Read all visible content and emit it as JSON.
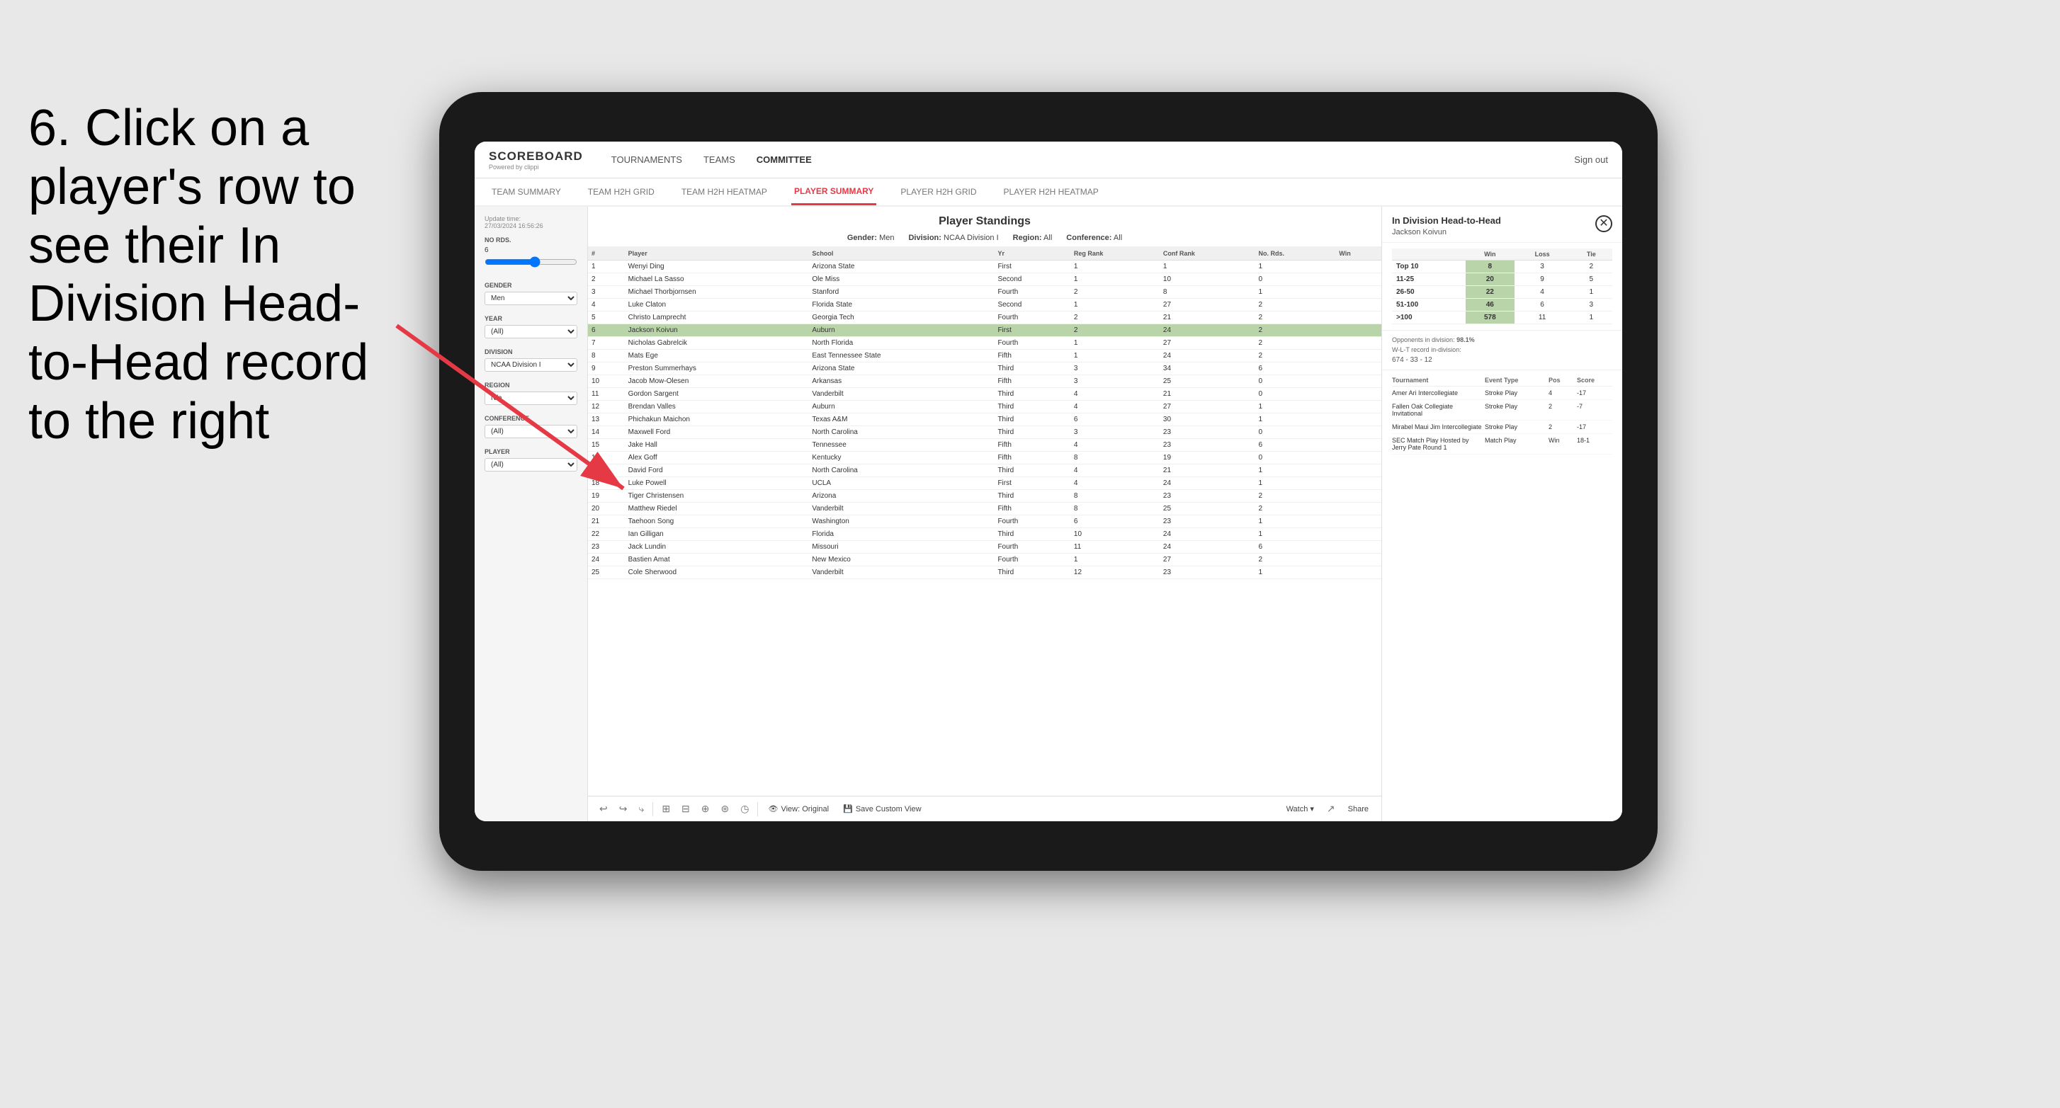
{
  "instruction": {
    "text": "6. Click on a player's row to see their In Division Head-to-Head record to the right"
  },
  "app": {
    "logo": "SCOREBOARD",
    "logo_sub": "Powered by clippi",
    "nav_links": [
      {
        "label": "TOURNAMENTS",
        "active": false
      },
      {
        "label": "TEAMS",
        "active": false
      },
      {
        "label": "COMMITTEE",
        "active": true
      }
    ],
    "sign_out": "Sign out",
    "sub_nav": [
      {
        "label": "TEAM SUMMARY",
        "active": false
      },
      {
        "label": "TEAM H2H GRID",
        "active": false
      },
      {
        "label": "TEAM H2H HEATMAP",
        "active": false
      },
      {
        "label": "PLAYER SUMMARY",
        "active": true
      },
      {
        "label": "PLAYER H2H GRID",
        "active": false
      },
      {
        "label": "PLAYER H2H HEATMAP",
        "active": false
      }
    ]
  },
  "sidebar": {
    "update_label": "Update time:",
    "update_time": "27/03/2024 16:56:26",
    "no_rds_label": "No Rds.",
    "no_rds_value": "6",
    "gender_label": "Gender",
    "gender_value": "Men",
    "year_label": "Year",
    "year_value": "(All)",
    "division_label": "Division",
    "division_value": "NCAA Division I",
    "region_label": "Region",
    "region_value": "N/a",
    "conference_label": "Conference",
    "conference_value": "(All)",
    "player_label": "Player",
    "player_value": "(All)"
  },
  "panel": {
    "title": "Player Standings",
    "gender_label": "Gender:",
    "gender_value": "Men",
    "division_label": "Division:",
    "division_value": "NCAA Division I",
    "region_label": "Region:",
    "region_value": "All",
    "conference_label": "Conference:",
    "conference_value": "All"
  },
  "table": {
    "columns": [
      "#",
      "Player",
      "School",
      "Yr",
      "Reg Rank",
      "Conf Rank",
      "No. Rds.",
      "Win"
    ],
    "rows": [
      {
        "rank": 1,
        "player": "Wenyi Ding",
        "school": "Arizona State",
        "yr": "First",
        "reg": 1,
        "conf": 1,
        "rds": 1,
        "win": ""
      },
      {
        "rank": 2,
        "player": "Michael La Sasso",
        "school": "Ole Miss",
        "yr": "Second",
        "reg": 1,
        "conf": 10,
        "rds": 0,
        "win": ""
      },
      {
        "rank": 3,
        "player": "Michael Thorbjornsen",
        "school": "Stanford",
        "yr": "Fourth",
        "reg": 2,
        "conf": 8,
        "rds": 1,
        "win": ""
      },
      {
        "rank": 4,
        "player": "Luke Claton",
        "school": "Florida State",
        "yr": "Second",
        "reg": 1,
        "conf": 27,
        "rds": 2,
        "win": ""
      },
      {
        "rank": 5,
        "player": "Christo Lamprecht",
        "school": "Georgia Tech",
        "yr": "Fourth",
        "reg": 2,
        "conf": 21,
        "rds": 2,
        "win": ""
      },
      {
        "rank": 6,
        "player": "Jackson Koivun",
        "school": "Auburn",
        "yr": "First",
        "reg": 2,
        "conf": 24,
        "rds": 2,
        "win": "",
        "highlighted": true
      },
      {
        "rank": 7,
        "player": "Nicholas Gabrelcik",
        "school": "North Florida",
        "yr": "Fourth",
        "reg": 1,
        "conf": 27,
        "rds": 2,
        "win": ""
      },
      {
        "rank": 8,
        "player": "Mats Ege",
        "school": "East Tennessee State",
        "yr": "Fifth",
        "reg": 1,
        "conf": 24,
        "rds": 2,
        "win": ""
      },
      {
        "rank": 9,
        "player": "Preston Summerhays",
        "school": "Arizona State",
        "yr": "Third",
        "reg": 3,
        "conf": 34,
        "rds": 6,
        "win": ""
      },
      {
        "rank": 10,
        "player": "Jacob Mow-Olesen",
        "school": "Arkansas",
        "yr": "Fifth",
        "reg": 3,
        "conf": 25,
        "rds": 0,
        "win": ""
      },
      {
        "rank": 11,
        "player": "Gordon Sargent",
        "school": "Vanderbilt",
        "yr": "Third",
        "reg": 4,
        "conf": 21,
        "rds": 0,
        "win": ""
      },
      {
        "rank": 12,
        "player": "Brendan Valles",
        "school": "Auburn",
        "yr": "Third",
        "reg": 4,
        "conf": 27,
        "rds": 1,
        "win": ""
      },
      {
        "rank": 13,
        "player": "Phichakun Maichon",
        "school": "Texas A&M",
        "yr": "Third",
        "reg": 6,
        "conf": 30,
        "rds": 1,
        "win": ""
      },
      {
        "rank": 14,
        "player": "Maxwell Ford",
        "school": "North Carolina",
        "yr": "Third",
        "reg": 3,
        "conf": 23,
        "rds": 0,
        "win": ""
      },
      {
        "rank": 15,
        "player": "Jake Hall",
        "school": "Tennessee",
        "yr": "Fifth",
        "reg": 4,
        "conf": 23,
        "rds": 6,
        "win": ""
      },
      {
        "rank": 16,
        "player": "Alex Goff",
        "school": "Kentucky",
        "yr": "Fifth",
        "reg": 8,
        "conf": 19,
        "rds": 0,
        "win": ""
      },
      {
        "rank": 17,
        "player": "David Ford",
        "school": "North Carolina",
        "yr": "Third",
        "reg": 4,
        "conf": 21,
        "rds": 1,
        "win": ""
      },
      {
        "rank": 18,
        "player": "Luke Powell",
        "school": "UCLA",
        "yr": "First",
        "reg": 4,
        "conf": 24,
        "rds": 1,
        "win": ""
      },
      {
        "rank": 19,
        "player": "Tiger Christensen",
        "school": "Arizona",
        "yr": "Third",
        "reg": 8,
        "conf": 23,
        "rds": 2,
        "win": ""
      },
      {
        "rank": 20,
        "player": "Matthew Riedel",
        "school": "Vanderbilt",
        "yr": "Fifth",
        "reg": 8,
        "conf": 25,
        "rds": 2,
        "win": ""
      },
      {
        "rank": 21,
        "player": "Taehoon Song",
        "school": "Washington",
        "yr": "Fourth",
        "reg": 6,
        "conf": 23,
        "rds": 1,
        "win": ""
      },
      {
        "rank": 22,
        "player": "Ian Gilligan",
        "school": "Florida",
        "yr": "Third",
        "reg": 10,
        "conf": 24,
        "rds": 1,
        "win": ""
      },
      {
        "rank": 23,
        "player": "Jack Lundin",
        "school": "Missouri",
        "yr": "Fourth",
        "reg": 11,
        "conf": 24,
        "rds": 6,
        "win": ""
      },
      {
        "rank": 24,
        "player": "Bastien Amat",
        "school": "New Mexico",
        "yr": "Fourth",
        "reg": 1,
        "conf": 27,
        "rds": 2,
        "win": ""
      },
      {
        "rank": 25,
        "player": "Cole Sherwood",
        "school": "Vanderbilt",
        "yr": "Third",
        "reg": 12,
        "conf": 23,
        "rds": 1,
        "win": ""
      }
    ]
  },
  "toolbar": {
    "buttons": [
      "↩",
      "↪",
      "⤷",
      "⊞",
      "⊟",
      "⊕",
      "⊛",
      "◷"
    ],
    "view_original": "View: Original",
    "save_custom": "Save Custom View",
    "watch": "Watch ▾",
    "share": "Share"
  },
  "h2h": {
    "title": "In Division Head-to-Head",
    "player": "Jackson Koivun",
    "columns": [
      "Win",
      "Loss",
      "Tie"
    ],
    "rows": [
      {
        "label": "Top 10",
        "win": 8,
        "loss": 3,
        "tie": 2
      },
      {
        "label": "11-25",
        "win": 20,
        "loss": 9,
        "tie": 5
      },
      {
        "label": "26-50",
        "win": 22,
        "loss": 4,
        "tie": 1
      },
      {
        "label": "51-100",
        "win": 46,
        "loss": 6,
        "tie": 3
      },
      {
        "label": ">100",
        "win": 578,
        "loss": 11,
        "tie": 1
      }
    ],
    "opponents_label": "Opponents in division:",
    "opponents_pct": "98.1%",
    "wlt_label": "W-L-T record in-division:",
    "wlt_record": "674 - 33 - 12",
    "tournaments_columns": [
      "Tournament",
      "Event Type",
      "Pos",
      "Score"
    ],
    "tournaments": [
      {
        "name": "Amer Ari Intercollegiate",
        "type": "Stroke Play",
        "pos": 4,
        "score": "-17"
      },
      {
        "name": "Fallen Oak Collegiate Invitational",
        "type": "Stroke Play",
        "pos": 2,
        "score": "-7"
      },
      {
        "name": "Mirabel Maui Jim Intercollegiate",
        "type": "Stroke Play",
        "pos": 2,
        "score": "-17"
      },
      {
        "name": "SEC Match Play Hosted by Jerry Pate Round 1",
        "type": "Match Play",
        "pos": "Win",
        "score": "18-1"
      }
    ]
  }
}
